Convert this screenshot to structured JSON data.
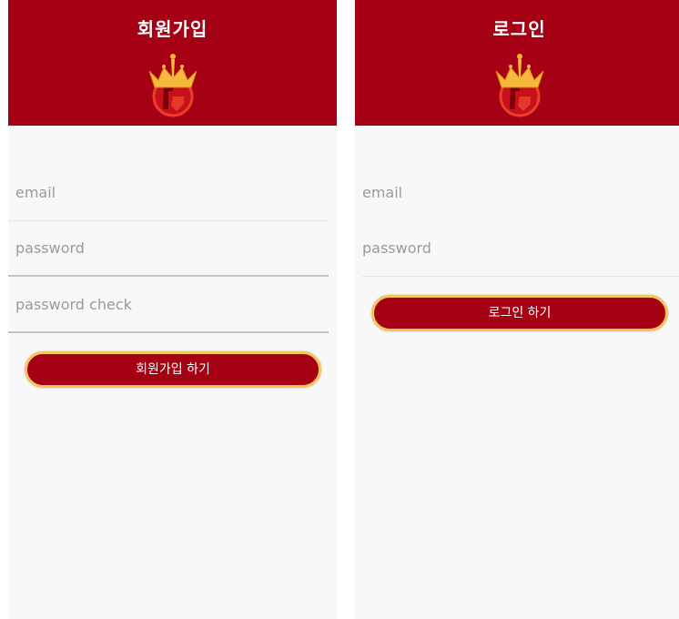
{
  "signup": {
    "title": "회원가입",
    "fields": [
      {
        "placeholder": "email",
        "value": ""
      },
      {
        "placeholder": "password",
        "value": ""
      },
      {
        "placeholder": "password check",
        "value": ""
      }
    ],
    "submit_label": "회원가입 하기"
  },
  "login": {
    "title": "로그인",
    "fields": [
      {
        "placeholder": "email",
        "value": ""
      },
      {
        "placeholder": "password",
        "value": ""
      }
    ],
    "submit_label": "로그인 하기"
  },
  "colors": {
    "header": "#a50013",
    "button": "#a50013",
    "button_border": "#f4c65a",
    "background": "#f8f8f8"
  },
  "icons": {
    "logo": "crown-logo-icon"
  }
}
